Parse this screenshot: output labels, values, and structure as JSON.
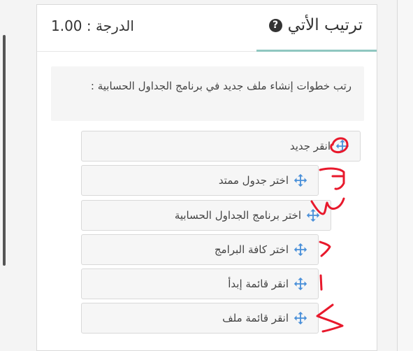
{
  "question": {
    "title": "ترتيب الأتي",
    "help_icon": "question-circle-icon",
    "grade_label": "الدرجة : 1.00",
    "prompt": "رتب خطوات إنشاء ملف جديد في برنامج الجداول الحسابية :"
  },
  "items": [
    {
      "label": "انقر جديد",
      "icon": "move-arrows-icon"
    },
    {
      "label": "اختر جدول ممتد",
      "icon": "move-arrows-icon"
    },
    {
      "label": "اختر برنامج الجداول الحسابية",
      "icon": "move-arrows-icon"
    },
    {
      "label": "اختر كافة البرامج",
      "icon": "move-arrows-icon"
    },
    {
      "label": "انقر قائمة إبدأ",
      "icon": "move-arrows-icon"
    },
    {
      "label": "انقر قائمة ملف",
      "icon": "move-arrows-icon"
    }
  ],
  "handwritten_numbers": [
    "٥",
    "٦",
    "٣",
    "٢",
    "١",
    "٤"
  ],
  "colors": {
    "accent": "#8fc7c0",
    "drag_icon": "#4a90d9",
    "ink": "#e8192c"
  }
}
